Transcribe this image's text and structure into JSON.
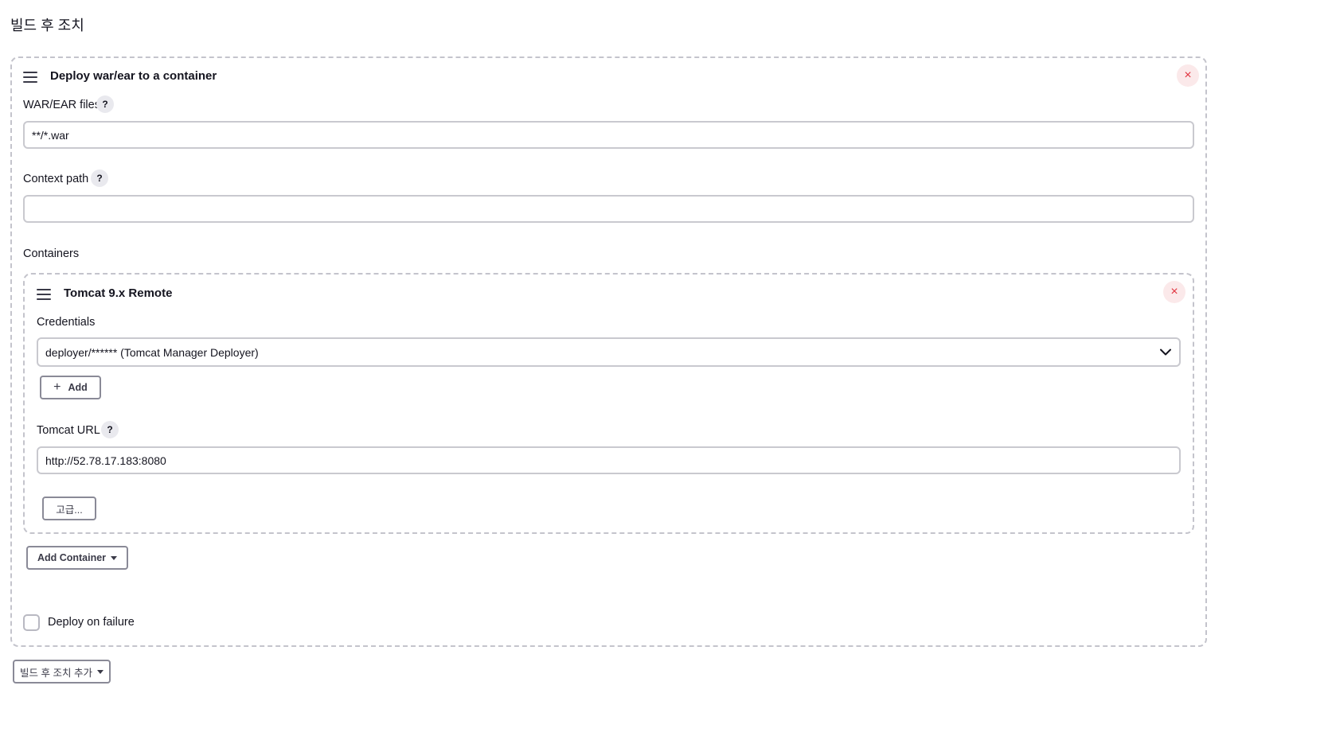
{
  "section": {
    "title": "빌드 후 조치"
  },
  "deploy_card": {
    "title": "Deploy war/ear to a container",
    "close_icon": "×",
    "war_ear": {
      "label": "WAR/EAR files",
      "help": "?",
      "value": "**/*.war"
    },
    "context_path": {
      "label": "Context path",
      "help": "?",
      "value": ""
    },
    "containers_label": "Containers",
    "container": {
      "title": "Tomcat 9.x Remote",
      "close_icon": "×",
      "credentials": {
        "label": "Credentials",
        "selected": "deployer/****** (Tomcat Manager Deployer)"
      },
      "add_button": {
        "icon": "+",
        "label": "Add"
      },
      "tomcat_url": {
        "label": "Tomcat URL",
        "help": "?",
        "value": "http://52.78.17.183:8080"
      },
      "advanced_button": "고급..."
    },
    "add_container_button": "Add Container",
    "deploy_on_failure": {
      "label": "Deploy on failure",
      "checked": false
    }
  },
  "add_post_build_button": "빌드 후 조치 추가",
  "colors": {
    "close_red": "#e0333f",
    "close_bg": "#fbe9ea",
    "border": "#c9c9cf"
  }
}
